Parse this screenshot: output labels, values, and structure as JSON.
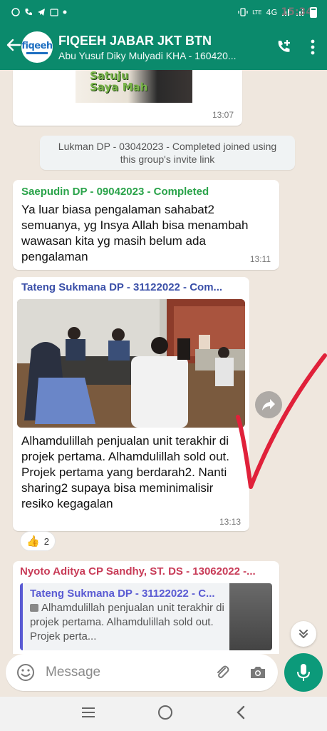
{
  "status_bar": {
    "time": "15:34",
    "network": "4G",
    "lte": "LTE"
  },
  "header": {
    "back_icon": "arrow-left",
    "avatar_logo": "fiqeeh",
    "title": "FIQEEH JABAR JKT BTN",
    "subtitle": "Abu Yusuf Diky Mulyadi KHA - 160420...",
    "add_call_icon": "phone-plus",
    "menu_icon": "more-vertical"
  },
  "messages": {
    "sticker": {
      "text_line1": "Satuju",
      "text_line2": "Saya Mah",
      "time": "13:07"
    },
    "system": {
      "line1": "Lukman DP - 03042023 - Completed joined using",
      "line2": "this group's invite link"
    },
    "msg1": {
      "sender": "Saepudin DP - 09042023 - Completed",
      "text": "Ya luar biasa pengalaman sahabat2 semuanya, yg Insya Allah bisa menambah wawasan kita yg masih belum ada pengalaman",
      "time": "13:11"
    },
    "msg2": {
      "sender": "Tateng Sukmana DP - 31122022 - Com...",
      "text": "Alhamdulillah penjualan unit terakhir di projek pertama. Alhamdulillah sold out. Projek pertama yang berdarah2. Nanti sharing2 supaya bisa meminimalisir resiko kegagalan",
      "time": "13:13",
      "reaction_emoji": "👍",
      "reaction_count": "2"
    },
    "msg3": {
      "sender": "Nyoto Aditya CP Sandhy, ST. DS - 13062022 -...",
      "quote_sender": "Tateng Sukmana DP - 31122022 - C...",
      "quote_text": "Alhamdulillah penjualan unit terakhir di projek pertama. Alhamdulillah sold out. Projek perta..."
    }
  },
  "composer": {
    "placeholder": "Message"
  },
  "colors": {
    "header_green": "#0b8a6c",
    "mic_green": "#0c9a7a",
    "chat_bg": "#efe7de",
    "check_red": "#e0213a"
  }
}
